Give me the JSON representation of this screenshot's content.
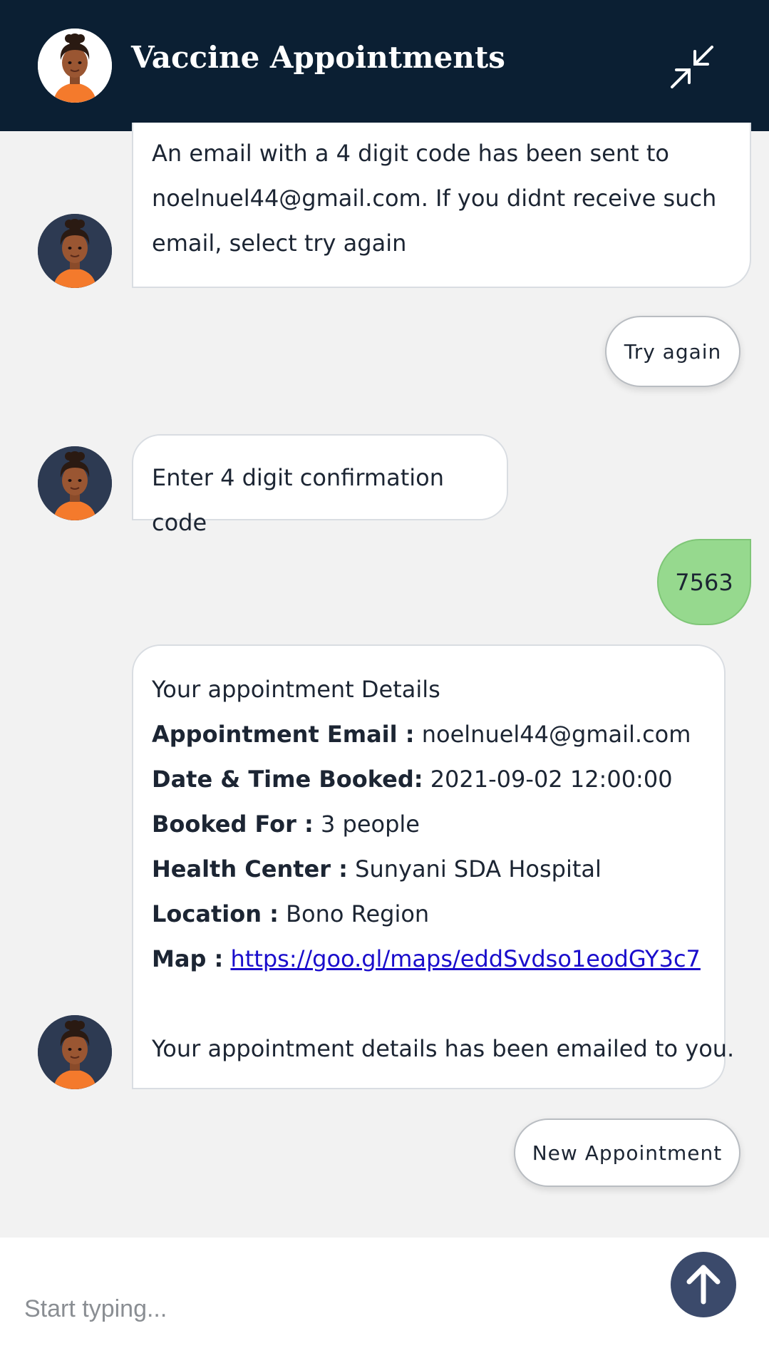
{
  "header": {
    "title": "Vaccine Appointments"
  },
  "messages": {
    "bot_email_sent": {
      "line1": "An email with a 4 digit code has been sent to",
      "line2": "noelnuel44@gmail.com. If you didnt receive such",
      "line3": "email, select try again"
    },
    "try_again_label": "Try again",
    "bot_enter_code": "Enter 4 digit confirmation code",
    "user_code": "7563",
    "appointment": {
      "heading": "Your appointment Details",
      "email_label": "Appointment Email :",
      "email_value": "noelnuel44@gmail.com",
      "datetime_label": "Date & Time Booked:",
      "datetime_value": "2021-09-02 12:00:00",
      "booked_for_label": "Booked For :",
      "booked_for_value": "3 people",
      "health_center_label": "Health Center :",
      "health_center_value": "Sunyani SDA Hospital",
      "location_label": "Location :",
      "location_value": "Bono Region",
      "map_label": "Map :",
      "map_link": "https://goo.gl/maps/eddSvdso1eodGY3c7",
      "footer": "Your appointment details has been emailed to you."
    },
    "new_appointment_label": "New Appointment"
  },
  "input": {
    "placeholder": "Start typing...",
    "value": ""
  },
  "colors": {
    "header_bg": "#0b1f33",
    "user_bubble": "#96d98e",
    "send_button": "#3b4a6b",
    "link": "#1a0dcc"
  },
  "icons": {
    "minimize": "minimize-arrows-icon",
    "send": "arrow-up-icon",
    "avatar": "agent-avatar-icon"
  }
}
